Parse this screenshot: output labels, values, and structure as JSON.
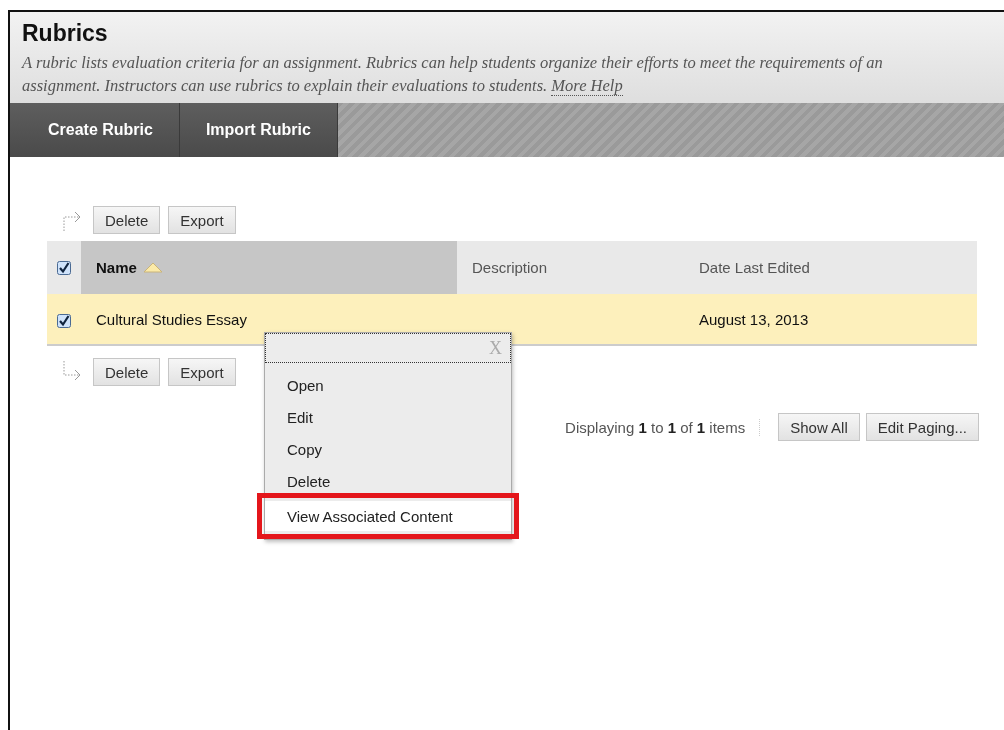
{
  "page": {
    "title": "Rubrics",
    "description": "A rubric lists evaluation criteria for an assignment. Rubrics can help students organize their efforts to meet the requirements of an assignment. Instructors can use rubrics to explain their evaluations to students.",
    "help_link": "More Help"
  },
  "tabs": [
    {
      "label": "Create Rubric"
    },
    {
      "label": "Import Rubric"
    }
  ],
  "top_actions": [
    "Delete",
    "Export"
  ],
  "table": {
    "select_all_checked": true,
    "columns": [
      {
        "label": "Name",
        "sorted": true
      },
      {
        "label": "Description",
        "sorted": false
      },
      {
        "label": "Date Last Edited",
        "sorted": false
      }
    ],
    "rows": [
      {
        "checked": true,
        "name": "Cultural Studies Essay",
        "date": "August 13, 2013"
      }
    ]
  },
  "bottom_actions": [
    "Delete",
    "Export"
  ],
  "paging": {
    "text": "Displaying **1** to **1** of **1** items",
    "buttons": [
      "Show All",
      "Edit Paging..."
    ]
  },
  "context_menu": {
    "close": "X",
    "items": [
      {
        "label": "Open",
        "highlighted": false
      },
      {
        "label": "Edit",
        "highlighted": false
      },
      {
        "label": "Copy",
        "highlighted": false
      },
      {
        "label": "Delete",
        "highlighted": false
      },
      {
        "label": "View Associated Content",
        "highlighted": true
      }
    ]
  }
}
